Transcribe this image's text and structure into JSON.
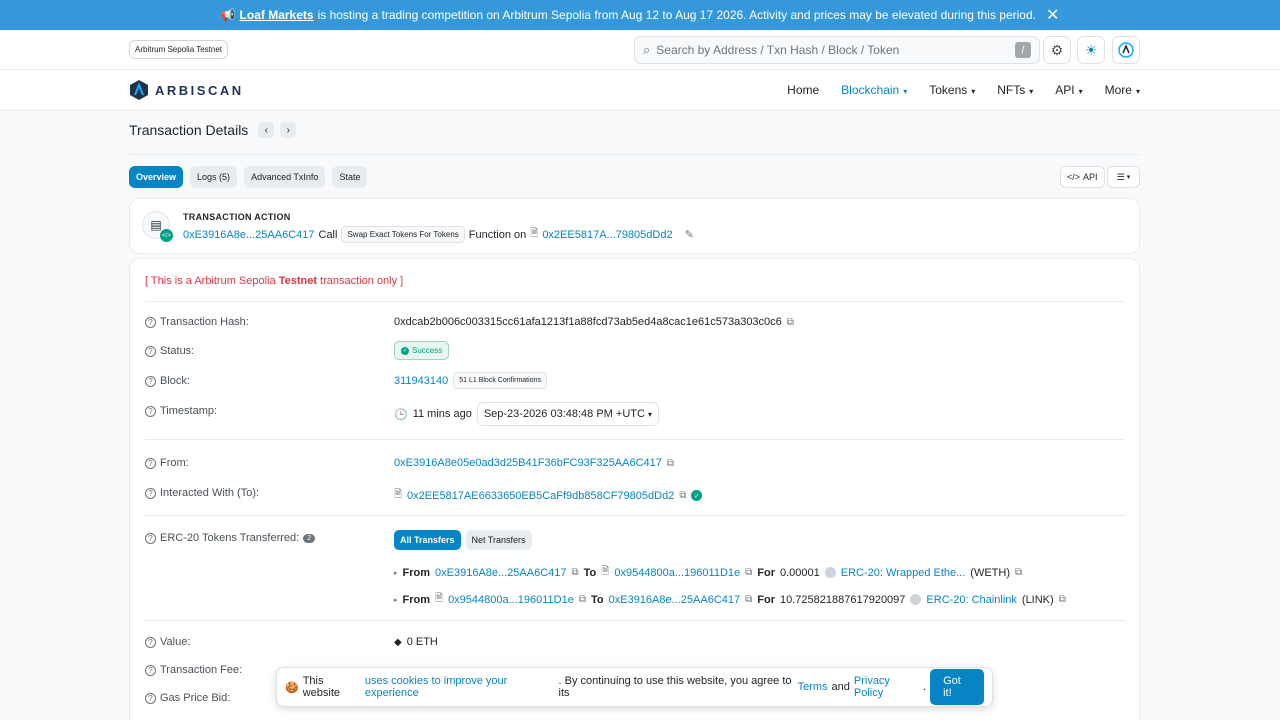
{
  "banner": {
    "icon": "megaphone-icon",
    "brand": "Loaf Markets",
    "message": "is hosting a trading competition on Arbitrum Sepolia from Aug 12 to Aug 17 2026. Activity and prices may be elevated during this period."
  },
  "topbar": {
    "network_badge": "Arbitrum Sepolia Testnet",
    "search_placeholder": "Search by Address / Txn Hash / Block / Token",
    "search_shortcut": "/"
  },
  "navbar": {
    "logo_text": "ARBISCAN",
    "items": [
      {
        "label": "Home"
      },
      {
        "label": "Blockchain"
      },
      {
        "label": "Tokens"
      },
      {
        "label": "NFTs"
      },
      {
        "label": "API"
      },
      {
        "label": "More"
      }
    ]
  },
  "page": {
    "title": "Transaction Details",
    "tabs": [
      "Overview",
      "Logs (5)",
      "Advanced TxInfo",
      "State"
    ],
    "api_button": "API"
  },
  "action": {
    "label": "TRANSACTION ACTION",
    "from": "0xE3916A8e...25AA6C417",
    "call": "Call",
    "method": "Swap Exact Tokens For Tokens",
    "function_on": "Function on",
    "contract": "0x2EE5817A...79805dDd2"
  },
  "details": {
    "testnet_prefix": "[ This is a Arbitrum Sepolia ",
    "testnet_bold": "Testnet",
    "testnet_suffix": " transaction only ]",
    "tx_hash_label": "Transaction Hash:",
    "tx_hash": "0xdcab2b006c003315cc61afa1213f1a88fcd73ab5ed4a8cac1e61c573a303c0c6",
    "status_label": "Status:",
    "status": "Success",
    "block_label": "Block:",
    "block": "311943140",
    "confirmations": "51 L1 Block Confirmations",
    "timestamp_label": "Timestamp:",
    "age": "11 mins ago",
    "timestamp": "Sep-23-2026 03:48:48 PM +UTC",
    "from_label": "From:",
    "from": "0xE3916A8e05e0ad3d25B41F36bFC93F325AA6C417",
    "to_label": "Interacted With (To):",
    "to": "0x2EE5817AE6633650EB5CaFf9db858CF79805dDd2",
    "erc20_label": "ERC-20 Tokens Transferred:",
    "erc20_count": "2",
    "all_transfers": "All Transfers",
    "net_transfers": "Net Transfers",
    "transfers": [
      {
        "from": "0xE3916A8e...25AA6C417",
        "to": "0x9544800a...196011D1e",
        "amount": "0.00001",
        "token": "ERC-20: Wrapped Ethe...",
        "symbol": "(WETH)"
      },
      {
        "from": "0x9544800a...196011D1e",
        "to": "0xE3916A8e...25AA6C417",
        "amount": "10.725821887617920097",
        "token": "ERC-20: Chainlink",
        "symbol": "(LINK)"
      }
    ],
    "from_word": "From",
    "to_word": "To",
    "for_word": "For",
    "value_label": "Value:",
    "value": "0 ETH",
    "fee_label": "Transaction Fee:",
    "gas_label": "Gas Price Bid:"
  },
  "cookie": {
    "prefix": "This website ",
    "link1": "uses cookies to improve your experience",
    "middle": ". By continuing to use this website, you agree to its ",
    "terms": "Terms",
    "and": " and ",
    "privacy": "Privacy Policy",
    "end": ".",
    "button": "Got it!"
  }
}
